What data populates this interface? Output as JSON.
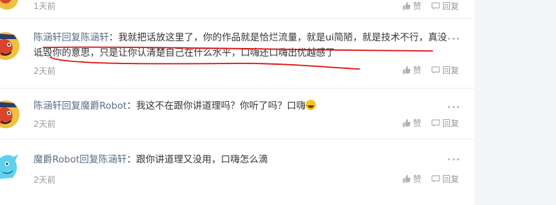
{
  "labels": {
    "like": "赞",
    "reply": "回复"
  },
  "top_fragment": {
    "time": "1天前"
  },
  "comments": [
    {
      "user": "陈涵轩",
      "verb": "回复",
      "target": "陈涵轩",
      "text": "我就把话放这里了，你的作品就是恰烂流量，就是ui简陋，就是技术不行，真没诋毁你的意思，只是让你认清楚自己在什么水平，口嗨还口嗨出优越感了",
      "time": "2天前"
    },
    {
      "user": "陈涵轩",
      "verb": "回复",
      "target": "魔爵Robot",
      "text": "我这不在跟你讲道理吗？你听了吗？口嗨",
      "time": "2天前",
      "emoji": "grinning-sweat-emoji"
    },
    {
      "user": "魔爵Robot",
      "verb": "回复",
      "target": "陈涵轩",
      "text": "跟你讲道理又没用，口嗨怎么滴",
      "time": "2天前"
    }
  ],
  "colors": {
    "username": "#5a6e86",
    "annotation": "#e01010",
    "sidebar": "#f4f5f7"
  }
}
